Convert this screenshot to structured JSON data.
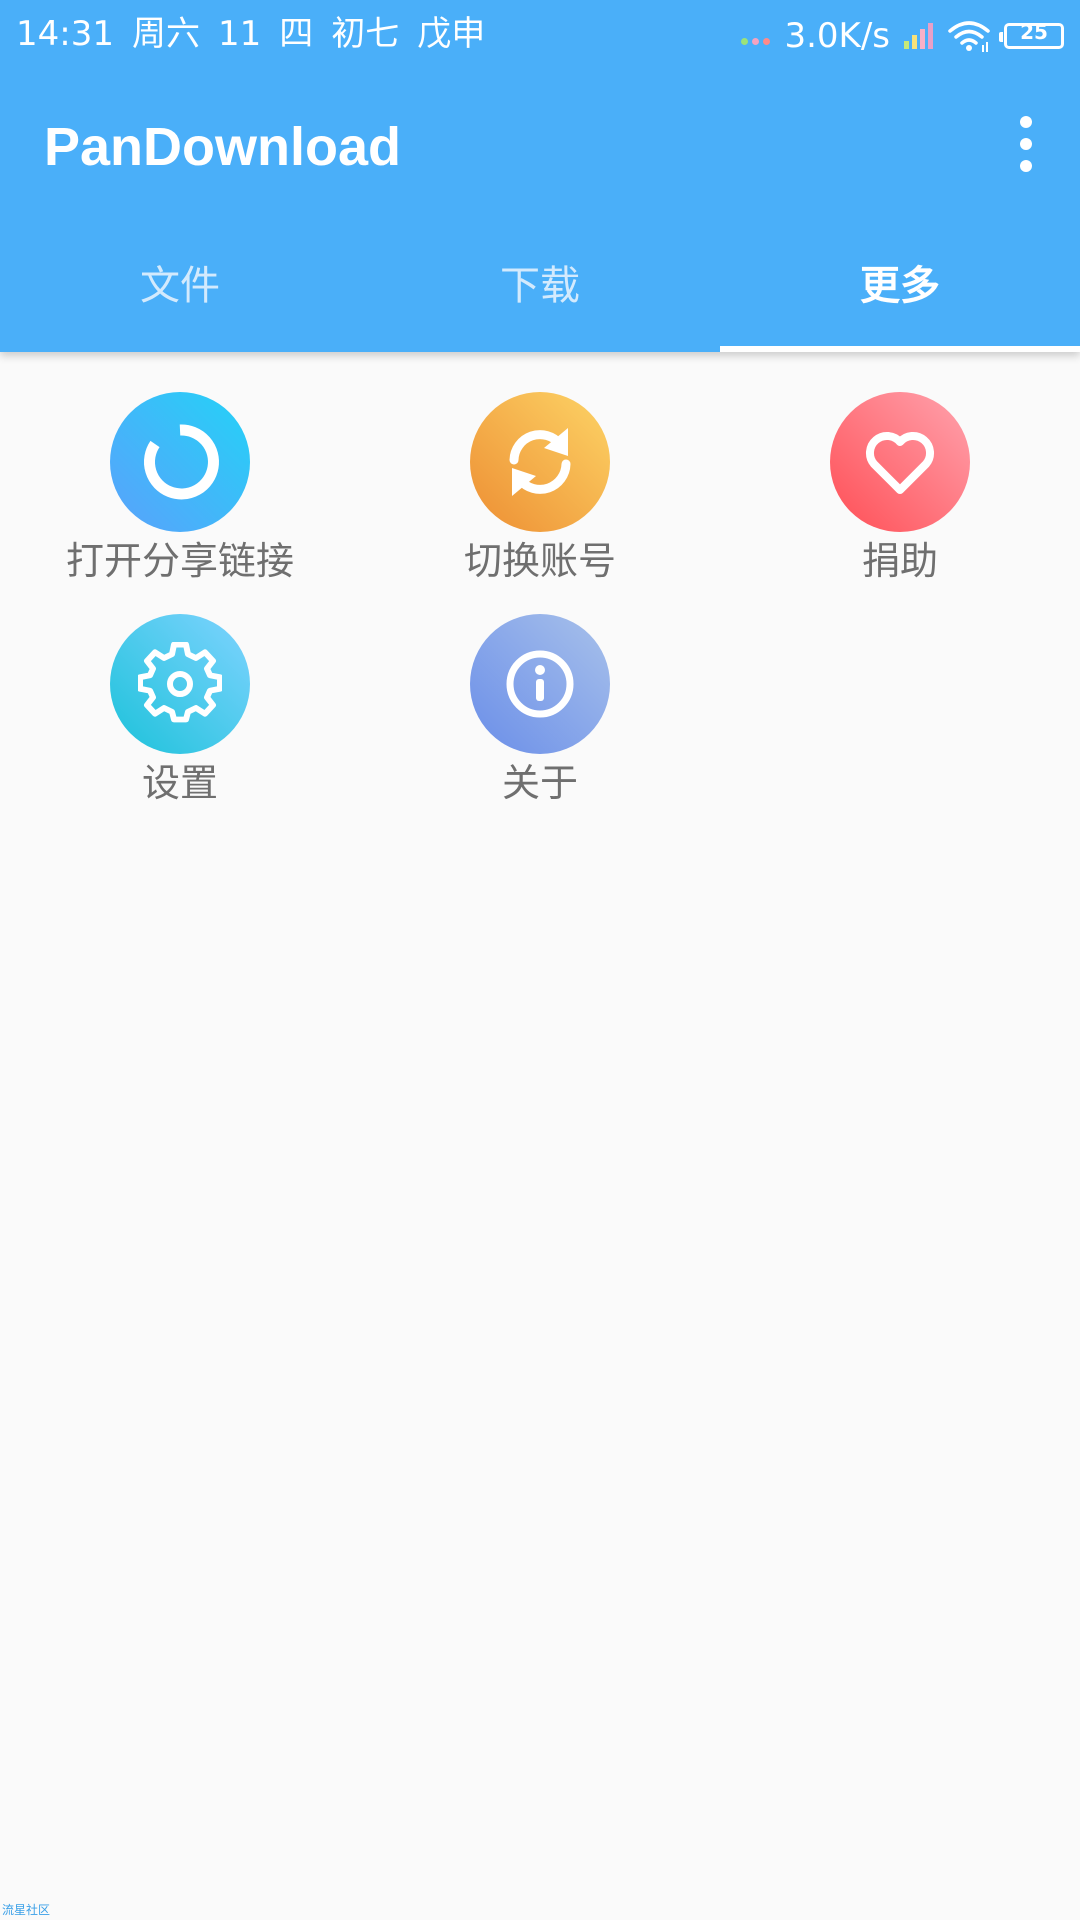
{
  "status_bar": {
    "time": "14:31",
    "weekday": "周六",
    "date": "11",
    "weekday_cn": "四",
    "lunar_day": "初七",
    "lunar_year": "戊申",
    "net_speed": "3.0K/s",
    "battery": "25"
  },
  "app_bar": {
    "title": "PanDownload"
  },
  "tabs": [
    {
      "label": "文件",
      "active": false
    },
    {
      "label": "下载",
      "active": false
    },
    {
      "label": "更多",
      "active": true
    }
  ],
  "grid": [
    {
      "label": "打开分享链接",
      "icon": "share-link-icon"
    },
    {
      "label": "切换账号",
      "icon": "switch-account-icon"
    },
    {
      "label": "捐助",
      "icon": "heart-icon"
    },
    {
      "label": "设置",
      "icon": "gear-icon"
    },
    {
      "label": "关于",
      "icon": "info-icon"
    }
  ],
  "watermark": "流星社区",
  "colors": {
    "primary": "#4aaff9",
    "background": "#fafafa",
    "label": "#6f6f6f"
  }
}
